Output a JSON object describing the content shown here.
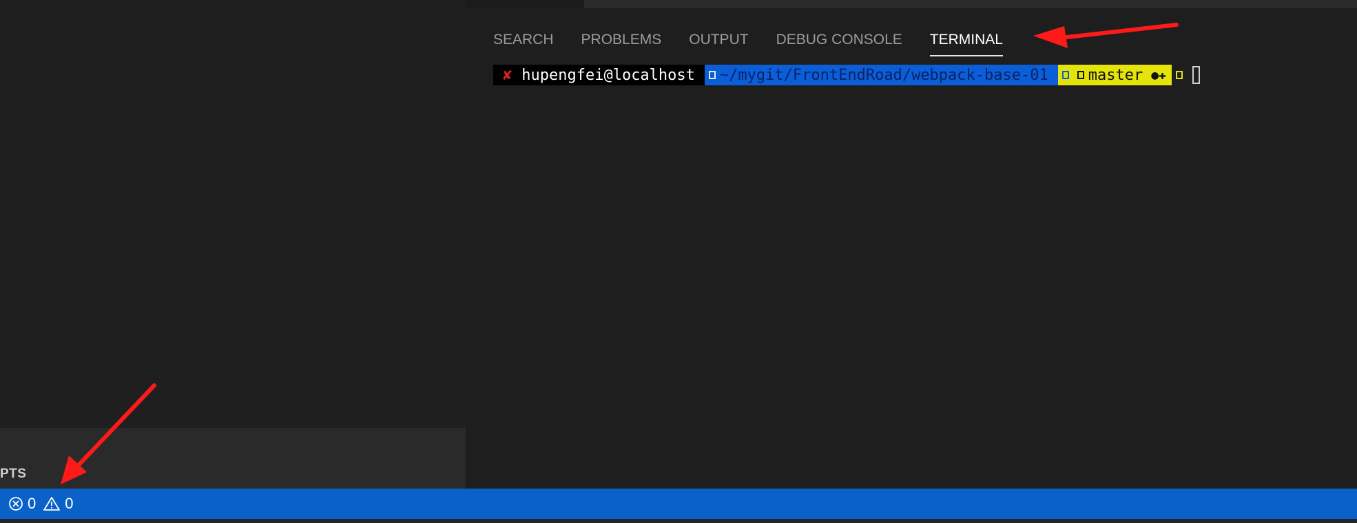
{
  "sidebar": {
    "section_title": "PTS"
  },
  "panel": {
    "tabs": [
      {
        "label": "SEARCH",
        "active": false
      },
      {
        "label": "PROBLEMS",
        "active": false
      },
      {
        "label": "OUTPUT",
        "active": false
      },
      {
        "label": "DEBUG CONSOLE",
        "active": false
      },
      {
        "label": "TERMINAL",
        "active": true
      }
    ]
  },
  "terminal": {
    "status_mark": "✘",
    "user_host": "hupengfei@localhost",
    "path": "~/mygit/FrontEndRoad/webpack-base-01",
    "branch": "master",
    "git_status": "●✚"
  },
  "statusbar": {
    "errors_count": "0",
    "warnings_count": "0"
  },
  "colors": {
    "statusbar_bg": "#0a62c9",
    "path_segment_bg": "#0a5fd8",
    "git_segment_bg": "#e5e40a",
    "error_mark": "#e0202a",
    "annotation_arrow": "#ff1a1a"
  },
  "icons": {
    "errors": "circle-x-icon",
    "warnings": "warning-triangle-icon",
    "prompt_separator": "powerline-separator-icon"
  }
}
